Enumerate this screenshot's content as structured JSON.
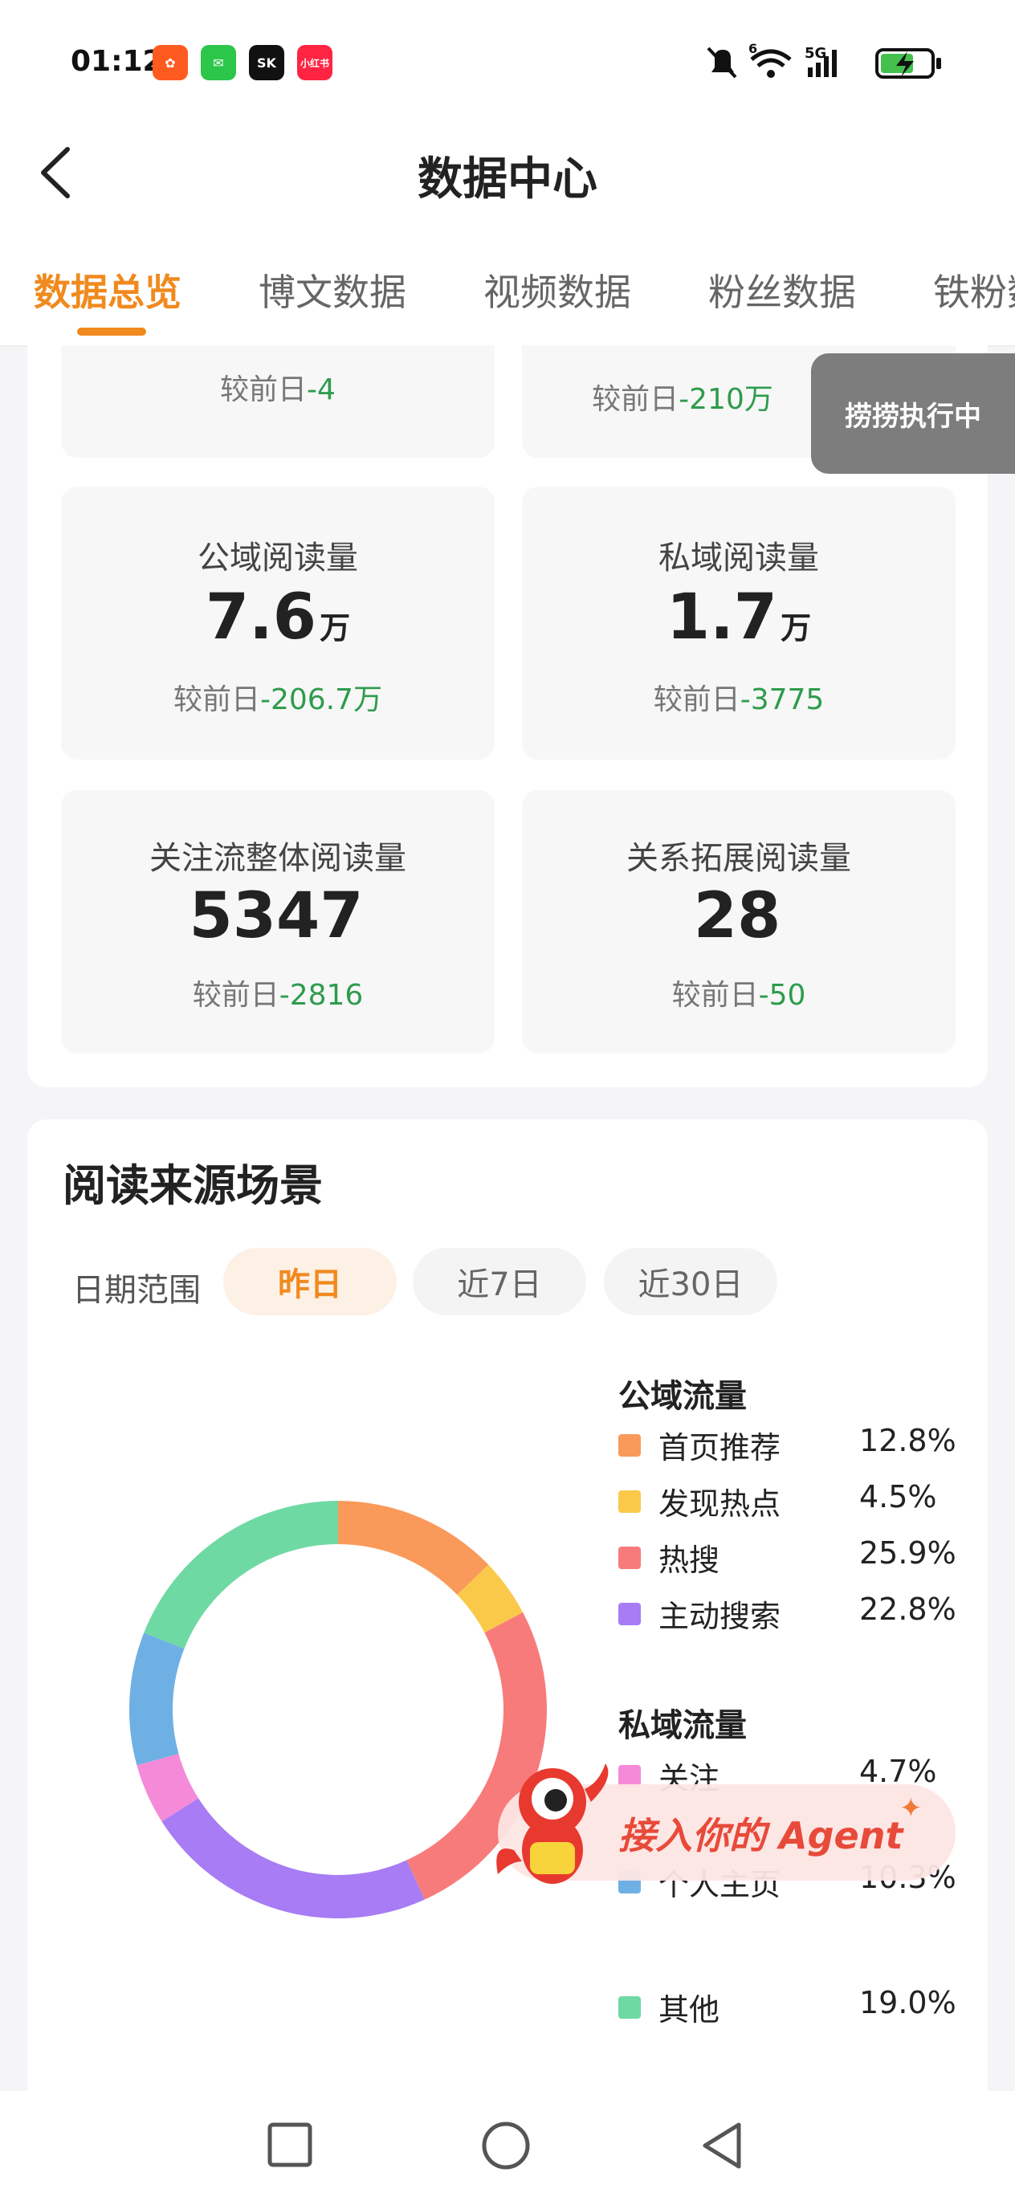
{
  "status_bar": {
    "time": "01:12",
    "app_icons": [
      {
        "name": "kuaishou-icon",
        "color": "#ff5a1f",
        "glyph": "✿"
      },
      {
        "name": "wechat-icon",
        "color": "#2bc64a",
        "glyph": "✉"
      },
      {
        "name": "sk-icon",
        "color": "#111111",
        "glyph": "SK"
      },
      {
        "name": "xiaohongshu-icon",
        "color": "#ff2442",
        "glyph": "小红书"
      }
    ],
    "network_label": "5G",
    "wifi_label": "6"
  },
  "header": {
    "title": "数据中心",
    "back_icon": "chevron-left-icon"
  },
  "tabs": [
    {
      "label": "数据总览",
      "active": true
    },
    {
      "label": "博文数据",
      "active": false
    },
    {
      "label": "视频数据",
      "active": false
    },
    {
      "label": "粉丝数据",
      "active": false
    },
    {
      "label": "铁粉数",
      "active": false
    }
  ],
  "toast": "捞捞执行中",
  "stats": {
    "partial_top_left_delta_prefix": "较前日",
    "partial_top_left_delta": "-4",
    "partial_top_right_delta_prefix": "较前日",
    "partial_top_right_delta": "-210万",
    "cards": [
      {
        "label": "公域阅读量",
        "value": "7.6",
        "unit": "万",
        "delta_prefix": "较前日",
        "delta": "-206.7万"
      },
      {
        "label": "私域阅读量",
        "value": "1.7",
        "unit": "万",
        "delta_prefix": "较前日",
        "delta": "-3775"
      },
      {
        "label": "关注流整体阅读量",
        "value": "5347",
        "unit": "",
        "delta_prefix": "较前日",
        "delta": "-2816"
      },
      {
        "label": "关系拓展阅读量",
        "value": "28",
        "unit": "",
        "delta_prefix": "较前日",
        "delta": "-50"
      }
    ]
  },
  "source": {
    "title": "阅读来源场景",
    "range_label": "日期范围",
    "ranges": [
      {
        "label": "昨日",
        "active": true
      },
      {
        "label": "近7日",
        "active": false
      },
      {
        "label": "近30日",
        "active": false
      }
    ],
    "public_title": "公域流量",
    "private_title": "私域流量",
    "public_items": [
      {
        "name": "首页推荐",
        "pct": "12.8%",
        "color": "#f99a5b"
      },
      {
        "name": "发现热点",
        "pct": "4.5%",
        "color": "#fbc94a"
      },
      {
        "name": "热搜",
        "pct": "25.9%",
        "color": "#f87b7b"
      },
      {
        "name": "主动搜索",
        "pct": "22.8%",
        "color": "#a77cf5"
      }
    ],
    "private_items": [
      {
        "name": "关注",
        "pct": "4.7%",
        "color": "#f58ad8"
      },
      {
        "name": "个人主页",
        "pct": "10.3%",
        "color": "#6fb0e4"
      },
      {
        "name": "其他",
        "pct": "19.0%",
        "color": "#6fd9a4"
      }
    ]
  },
  "agent_banner": "接入你的 Agent",
  "chart_data": {
    "type": "pie",
    "categories": [
      "首页推荐",
      "发现热点",
      "热搜",
      "主动搜索",
      "关注",
      "个人主页",
      "其他"
    ],
    "values": [
      12.8,
      4.5,
      25.9,
      22.8,
      4.7,
      10.3,
      19.0
    ],
    "colors": [
      "#f99a5b",
      "#fbc94a",
      "#f87b7b",
      "#a77cf5",
      "#f58ad8",
      "#6fb0e4",
      "#6fd9a4"
    ]
  }
}
